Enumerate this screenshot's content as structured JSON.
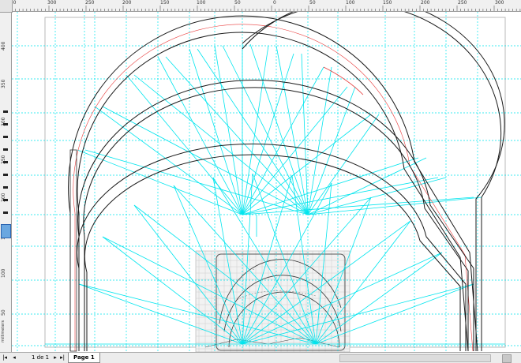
{
  "rulers": {
    "top_labels": [
      "350",
      "300",
      "250",
      "200",
      "150",
      "100",
      "50",
      "0",
      "50",
      "100",
      "150",
      "200",
      "250",
      "300"
    ],
    "left_labels": [
      "400",
      "350",
      "300",
      "250",
      "200",
      "150",
      "100",
      "50"
    ],
    "units": "millimeters"
  },
  "statusbar": {
    "first_page": "|◂",
    "prev_page": "◂",
    "page_indicator": "1 de 1",
    "next_page": "▸",
    "last_page": "▸|",
    "page_tab": "Page 1",
    "scroll_left": "◂"
  },
  "colors": {
    "guide": "#00e5ee",
    "outline": "#1a1a1a",
    "accent_red": "#e83a3a",
    "page_border": "#b0b0b0"
  }
}
